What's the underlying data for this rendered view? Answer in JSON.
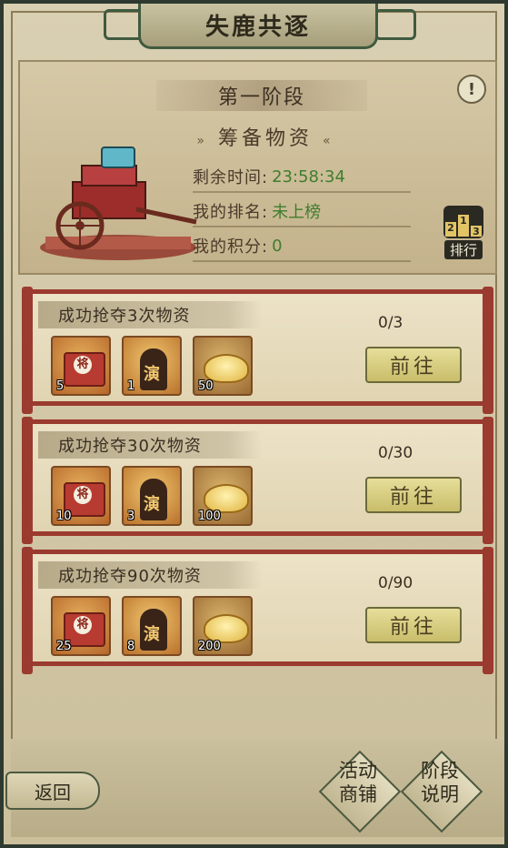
{
  "header": {
    "title": "失鹿共逐",
    "stage": "第一阶段",
    "subtitle": "筹备物资",
    "deco_left": "»",
    "deco_right": "«",
    "remaining_time_label": "剩余时间:",
    "remaining_time_value": "23:58:34",
    "my_rank_label": "我的排名:",
    "my_rank_value": "未上榜",
    "my_score_label": "我的积分:",
    "my_score_value": "0",
    "alert_icon": "!",
    "rank_button_label": "排行",
    "rank_podium": [
      "2",
      "1",
      "3"
    ]
  },
  "tasks": [
    {
      "title": "成功抢夺3次物资",
      "progress": "0/3",
      "go_label": "前往",
      "rewards": [
        {
          "icon": "general-chest-icon",
          "mark": "将",
          "count": "5"
        },
        {
          "icon": "figure-token-icon",
          "mark": "演",
          "count": "1"
        },
        {
          "icon": "gold-ingot-icon",
          "mark": "",
          "count": "50"
        }
      ]
    },
    {
      "title": "成功抢夺30次物资",
      "progress": "0/30",
      "go_label": "前往",
      "rewards": [
        {
          "icon": "general-chest-icon",
          "mark": "将",
          "count": "10"
        },
        {
          "icon": "figure-token-icon",
          "mark": "演",
          "count": "3"
        },
        {
          "icon": "gold-ingot-icon",
          "mark": "",
          "count": "100"
        }
      ]
    },
    {
      "title": "成功抢夺90次物资",
      "progress": "0/90",
      "go_label": "前往",
      "rewards": [
        {
          "icon": "general-chest-icon",
          "mark": "将",
          "count": "25"
        },
        {
          "icon": "figure-token-icon",
          "mark": "演",
          "count": "8"
        },
        {
          "icon": "gold-ingot-icon",
          "mark": "",
          "count": "200"
        }
      ]
    }
  ],
  "footer": {
    "back_label": "返回",
    "shop_line1": "活动",
    "shop_line2": "商铺",
    "info_line1": "阶段",
    "info_line2": "说明"
  },
  "colors": {
    "accent_green": "#3f7d2e",
    "frame_red": "#9b3a2e",
    "button_gold": "#c9bd6a"
  }
}
